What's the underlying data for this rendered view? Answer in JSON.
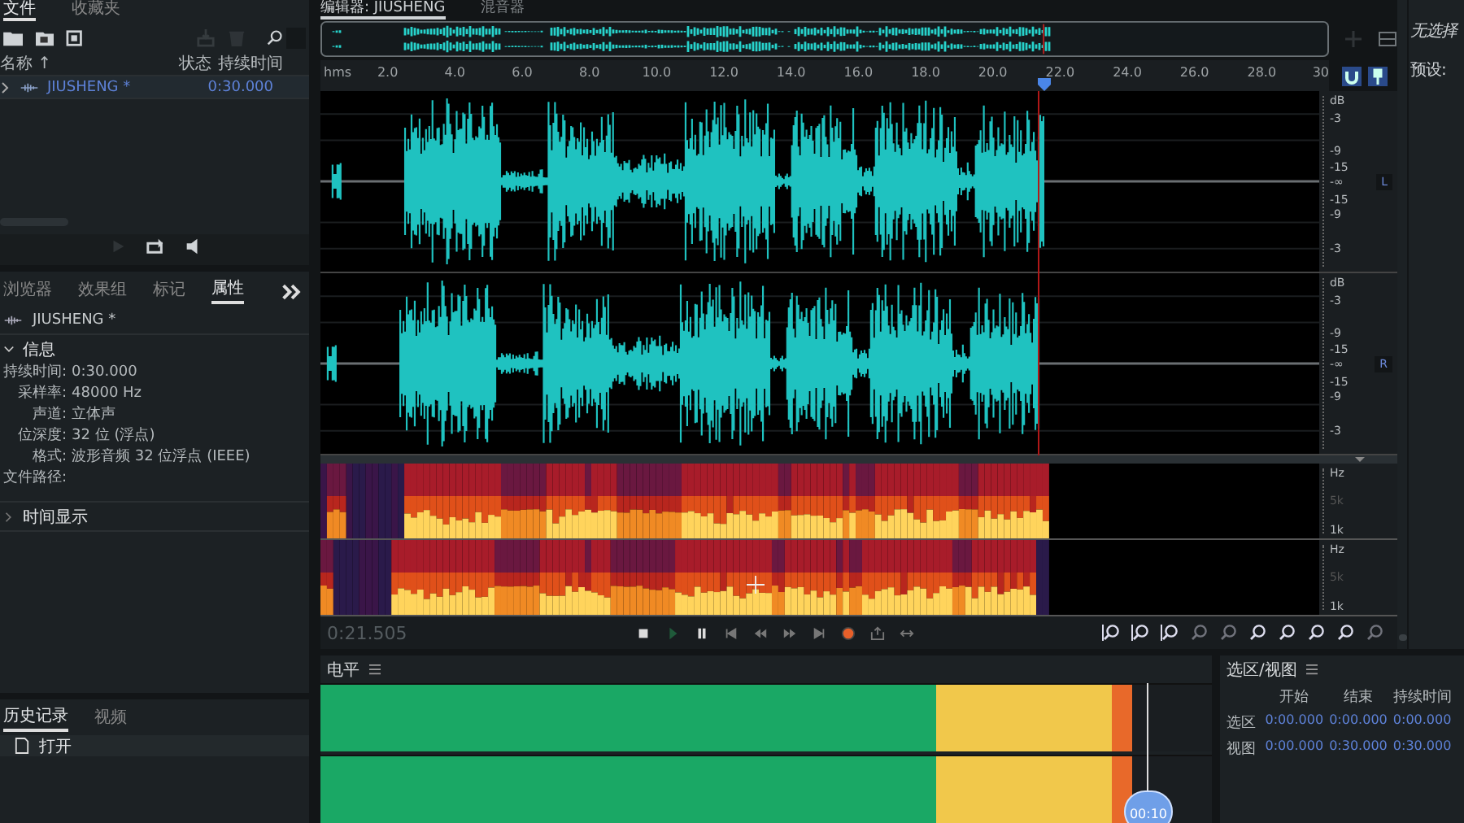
{
  "files_panel": {
    "tabs": [
      {
        "label": "文件",
        "selected": true
      },
      {
        "label": "收藏夹",
        "selected": false
      }
    ],
    "columns": [
      "名称 ↑",
      "状态",
      "持续时间"
    ],
    "files": [
      {
        "name": "JIUSHENG *",
        "duration": "0:30.000",
        "selected": true
      }
    ]
  },
  "properties_panel": {
    "tabs": [
      {
        "label": "浏览器",
        "selected": false
      },
      {
        "label": "效果组",
        "selected": false
      },
      {
        "label": "标记",
        "selected": false
      },
      {
        "label": "属性",
        "selected": true
      }
    ],
    "file_name": "JIUSHENG *",
    "info": {
      "title": "信息",
      "expanded": true,
      "fields": [
        {
          "label": "持续时间:",
          "value": "0:30.000"
        },
        {
          "label": "采样率:",
          "value": "48000 Hz"
        },
        {
          "label": "声道:",
          "value": "立体声"
        },
        {
          "label": "位深度:",
          "value": "32 位 (浮点)"
        },
        {
          "label": "格式:",
          "value": "波形音频 32 位浮点 (IEEE)"
        },
        {
          "label": "文件路径:"
        }
      ]
    },
    "time_display": {
      "title": "时间显示",
      "expanded": false
    }
  },
  "history_panel": {
    "tabs": [
      {
        "label": "历史记录",
        "selected": true
      },
      {
        "label": "视频",
        "selected": false
      }
    ],
    "items": [
      {
        "label": "打开"
      }
    ]
  },
  "editor": {
    "tabs": [
      {
        "label": "编辑器: JIUSHENG",
        "selected": true
      },
      {
        "label": "混音器",
        "selected": false
      }
    ],
    "ruler": {
      "unit": "hms",
      "ticks": [
        "2.0",
        "4.0",
        "6.0",
        "8.0",
        "10.0",
        "12.0",
        "14.0",
        "16.0",
        "18.0",
        "20.0",
        "22.0",
        "24.0",
        "26.0",
        "28.0",
        "30"
      ]
    },
    "playhead": {
      "level": 0.717
    },
    "channels": [
      {
        "label": "L",
        "scale": [
          "dB",
          "-3",
          "-9",
          "-15",
          "-∞",
          "-15",
          "-9",
          "-3"
        ]
      },
      {
        "label": "R",
        "scale": [
          "dB",
          "-3",
          "-9",
          "-15",
          "-∞",
          "-15",
          "-9",
          "-3"
        ]
      }
    ],
    "spectral": [
      {
        "scale": [
          "Hz",
          "5k",
          "1k"
        ]
      },
      {
        "scale": [
          "Hz",
          "5k",
          "1k"
        ]
      }
    ],
    "time": "0:21.505"
  },
  "right_panel": {
    "lines": [
      "无选择",
      "预设:"
    ]
  },
  "levels_panel": {
    "title": "电平",
    "channels": [
      {
        "level": 0.91
      },
      {
        "level": 0.91
      }
    ],
    "badge": "00:10"
  },
  "selection_panel": {
    "title": "选区/视图",
    "columns": [
      "开始",
      "结束",
      "持续时间"
    ],
    "rows": [
      {
        "label": "选区",
        "values": [
          "0:00.000",
          "0:00.000",
          "0:00.000"
        ]
      },
      {
        "label": "视图",
        "values": [
          "0:00.000",
          "0:30.000",
          "0:30.000"
        ]
      }
    ]
  }
}
